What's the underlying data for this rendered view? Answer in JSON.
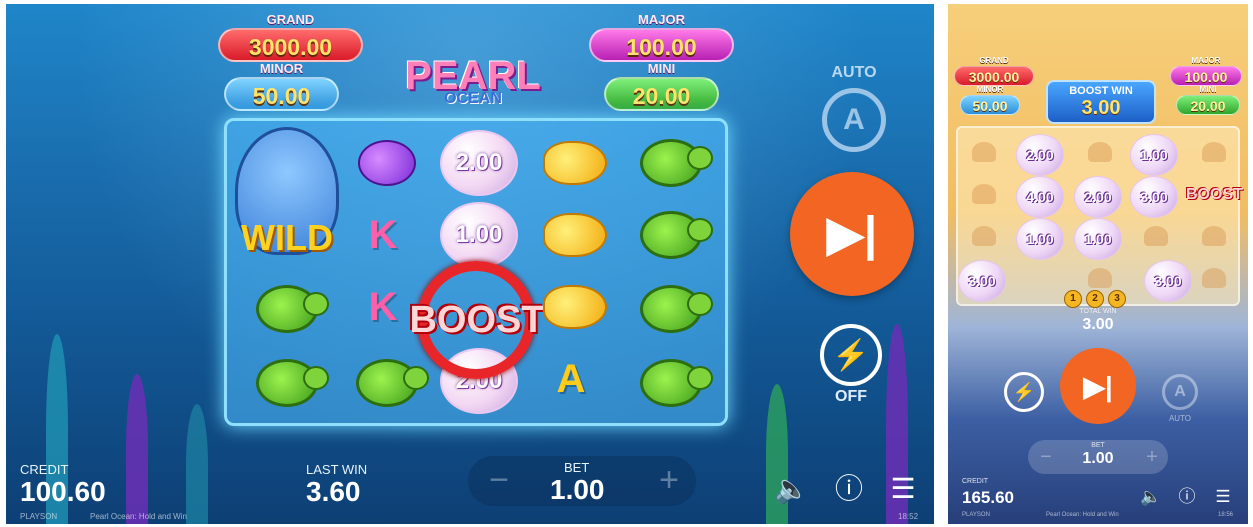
{
  "landscape": {
    "jackpots": {
      "grand": {
        "label": "GRAND",
        "value": "3000.00"
      },
      "minor": {
        "label": "MINOR",
        "value": "50.00"
      },
      "major": {
        "label": "MAJOR",
        "value": "100.00"
      },
      "mini": {
        "label": "MINI",
        "value": "20.00"
      }
    },
    "logo": {
      "line1": "PEARL",
      "line2": "OCEAN"
    },
    "reels": {
      "wild_label": "WILD",
      "boost_label": "BOOST",
      "k1": "K",
      "k2": "K",
      "a1": "A",
      "pearl_values": [
        "2.00",
        "1.00",
        "2.00"
      ]
    },
    "controls": {
      "auto_label": "AUTO",
      "auto_icon_glyph": "A",
      "spin_glyph": "▶|",
      "turbo_glyph": "⚡",
      "turbo_state": "OFF"
    },
    "hud": {
      "credit_label": "CREDIT",
      "credit_value": "100.60",
      "last_win_label": "LAST WIN",
      "last_win_value": "3.60",
      "bet_label": "BET",
      "bet_value": "1.00",
      "minus": "−",
      "plus": "+",
      "sound_glyph": "🔈",
      "info_glyph": "ⓘ",
      "menu_glyph": "☰"
    },
    "footer": {
      "provider": "PLAYSON",
      "game_name": "Pearl Ocean: Hold and Win",
      "clock": "18:52"
    }
  },
  "portrait": {
    "jackpots": {
      "grand": {
        "label": "GRAND",
        "value": "3000.00"
      },
      "minor": {
        "label": "MINOR",
        "value": "50.00"
      },
      "major": {
        "label": "MAJOR",
        "value": "100.00"
      },
      "mini": {
        "label": "MINI",
        "value": "20.00"
      }
    },
    "boost_win": {
      "label": "BOOST WIN",
      "value": "3.00"
    },
    "pearls": [
      "2.00",
      "1.00",
      "4.00",
      "2.00",
      "3.00",
      "1.00",
      "1.00",
      "3.00",
      "3.00"
    ],
    "boost_label": "BOOST",
    "respins": [
      "1",
      "2",
      "3"
    ],
    "total_win": {
      "label": "TOTAL WIN",
      "value": "3.00"
    },
    "controls": {
      "turbo_glyph": "⚡",
      "spin_glyph": "▶|",
      "auto_glyph": "A",
      "auto_label": "AUTO"
    },
    "bet": {
      "label": "BET",
      "value": "1.00",
      "minus": "−",
      "plus": "+"
    },
    "credit": {
      "label": "CREDIT",
      "value": "165.60"
    },
    "icons": {
      "sound": "🔈",
      "info": "ⓘ",
      "menu": "☰"
    },
    "footer": {
      "provider": "PLAYSON",
      "game_name": "Pearl Ocean: Hold and Win",
      "clock": "18:56"
    }
  },
  "colors": {
    "spin_orange": "#f26522",
    "sea_blue": "#1a6fb0",
    "sand": "#f2bd62"
  }
}
